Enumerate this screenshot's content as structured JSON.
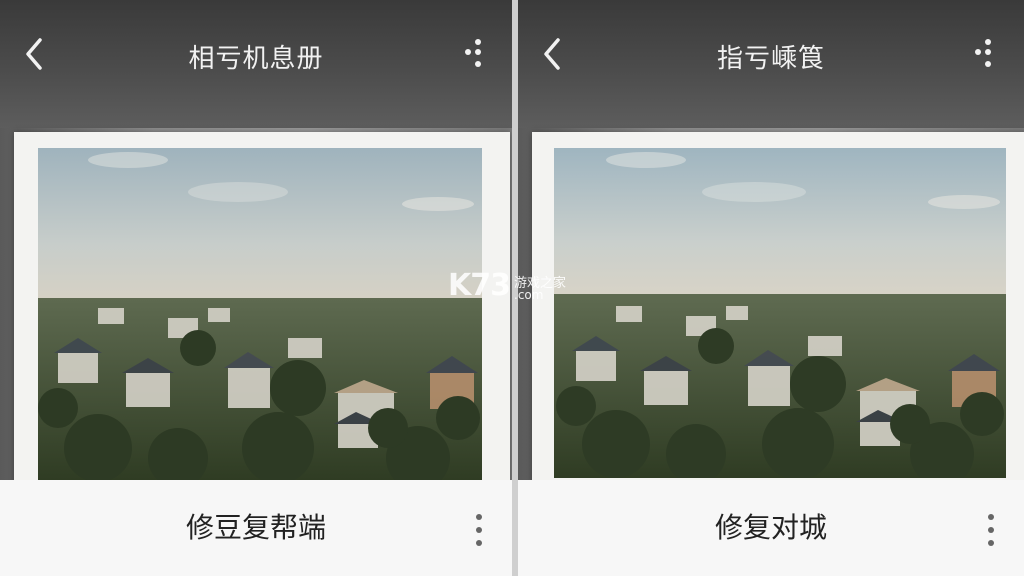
{
  "left_panel": {
    "title": "相亏机息册",
    "action_label": "修豆复帮端",
    "back_icon": "chevron-left-icon",
    "menu_icon": "more-vertical-icon"
  },
  "right_panel": {
    "title": "指亏嵊筤",
    "action_label": "修复对城",
    "back_icon": "chevron-left-icon",
    "menu_icon": "more-vertical-icon"
  },
  "watermark": {
    "logo": "K73",
    "text": "游戏之家",
    "domain": ".com"
  },
  "colors": {
    "topbar": "#3f3f3f",
    "bottombar": "#f7f7f7",
    "title_text": "#f2f2f2",
    "action_text": "#222222"
  }
}
